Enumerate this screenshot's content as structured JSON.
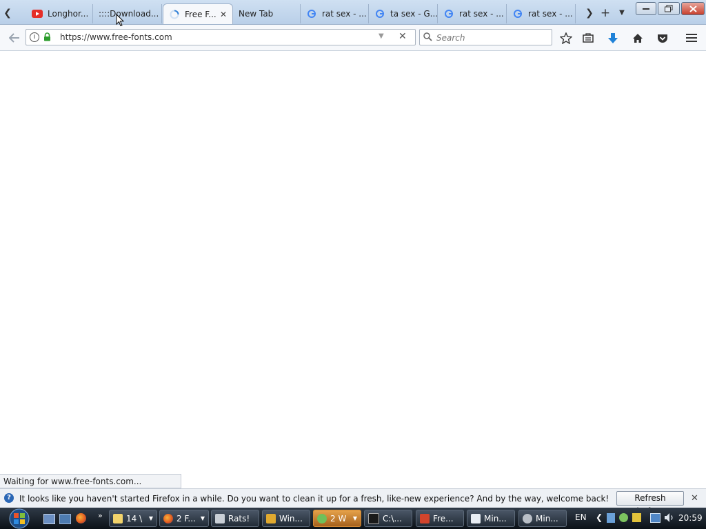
{
  "tabs": [
    {
      "title": "Longhor...",
      "icon": "youtube-icon"
    },
    {
      "title": "::::Download...",
      "icon": "none"
    },
    {
      "title": "Free F...",
      "icon": "loading-spinner-icon",
      "close": "✕"
    },
    {
      "title": "New Tab",
      "icon": "none"
    },
    {
      "title": "rat sex - ...",
      "icon": "google-icon"
    },
    {
      "title": "ta sex - G...",
      "icon": "google-icon"
    },
    {
      "title": "rat sex - ...",
      "icon": "google-icon"
    },
    {
      "title": "rat sex - ...",
      "icon": "google-icon"
    }
  ],
  "url": "https://www.free-fonts.com",
  "search_placeholder": "Search",
  "status_text": "Waiting for www.free-fonts.com...",
  "notification": {
    "text": "It looks like you haven't started Firefox in a while. Do you want to clean it up for a fresh, like-new experience? And by the way, welcome back!",
    "button": "Refresh Firefox...",
    "close": "✕"
  },
  "taskbar": {
    "items": [
      {
        "label": "14 \\"
      },
      {
        "label": "2 F..."
      },
      {
        "label": "Rats!"
      },
      {
        "label": "Win..."
      },
      {
        "label": "2 W"
      },
      {
        "label": "C:\\..."
      },
      {
        "label": "Fre..."
      },
      {
        "label": "Min..."
      },
      {
        "label": "Min..."
      }
    ],
    "language": "EN",
    "time": "20:59"
  }
}
